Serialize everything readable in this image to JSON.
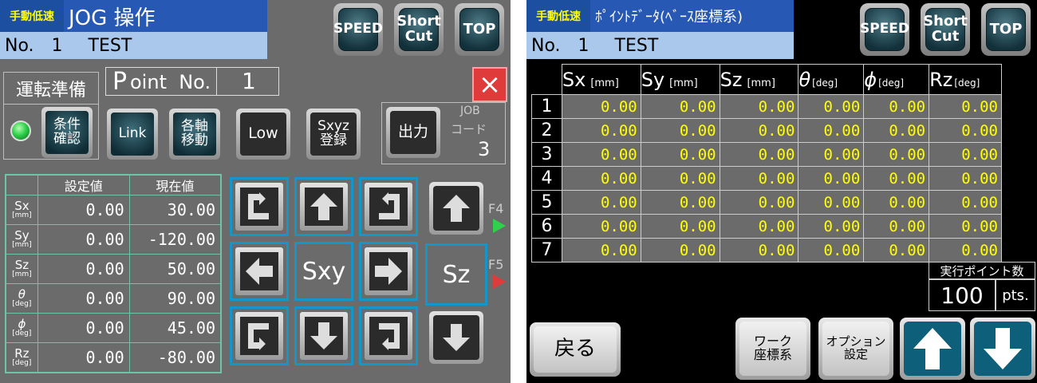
{
  "left": {
    "header": {
      "mode_tag": "手動低速",
      "title": "JOG 操作",
      "no_label": "No.",
      "no_value": "1",
      "name": "TEST"
    },
    "top_buttons": {
      "speed": "SPEED",
      "shortcut_1": "Short",
      "shortcut_2": "Cut",
      "top": "TOP"
    },
    "ready": {
      "label": "運転準備",
      "check_button": "条件\n確認"
    },
    "point": {
      "label_P": "P",
      "label_rest": "oint  No.",
      "value": "1"
    },
    "close_label": "×",
    "buttons": {
      "link": "Link",
      "axis_move": "各軸\n移動",
      "low": "Low",
      "sxyz_register": "Sxyz\n登録",
      "output": "出力"
    },
    "job_code": {
      "label1": "JOB",
      "label2": "コード",
      "value": "3"
    },
    "axis_table": {
      "headers": [
        "設定値",
        "現在値"
      ],
      "rows": [
        {
          "name": "Sx",
          "unit": "[mm]",
          "set": "0.00",
          "current": "30.00"
        },
        {
          "name": "Sy",
          "unit": "[mm]",
          "set": "0.00",
          "current": "-120.00"
        },
        {
          "name": "Sz",
          "unit": "[mm]",
          "set": "0.00",
          "current": "50.00"
        },
        {
          "name": "θ",
          "unit": "[deg]",
          "set": "0.00",
          "current": "90.00"
        },
        {
          "name": "ϕ",
          "unit": "[deg]",
          "set": "0.00",
          "current": "45.00"
        },
        {
          "name": "Rz",
          "unit": "[deg]",
          "set": "0.00",
          "current": "-80.00"
        }
      ]
    },
    "jog": {
      "sxy_label": "Sxy",
      "sz_label": "Sz",
      "f4": "F4",
      "f5": "F5"
    }
  },
  "right": {
    "header": {
      "mode_tag": "手動低速",
      "title": "ﾎﾟｲﾝﾄﾃﾞｰﾀ(ﾍﾞｰｽ座標系)",
      "no_label": "No.",
      "no_value": "1",
      "name": "TEST"
    },
    "top_buttons": {
      "speed": "SPEED",
      "shortcut_1": "Short",
      "shortcut_2": "Cut",
      "top": "TOP"
    },
    "table": {
      "headers": [
        {
          "name": "Sx",
          "unit": "[mm]"
        },
        {
          "name": "Sy",
          "unit": "[mm]"
        },
        {
          "name": "Sz",
          "unit": "[mm]"
        },
        {
          "name": "θ",
          "unit": "[deg]"
        },
        {
          "name": "ϕ",
          "unit": "[deg]"
        },
        {
          "name": "Rz",
          "unit": "[deg]"
        }
      ],
      "rows": [
        {
          "no": "1",
          "values": [
            "0.00",
            "0.00",
            "0.00",
            "0.00",
            "0.00",
            "0.00"
          ]
        },
        {
          "no": "2",
          "values": [
            "0.00",
            "0.00",
            "0.00",
            "0.00",
            "0.00",
            "0.00"
          ]
        },
        {
          "no": "3",
          "values": [
            "0.00",
            "0.00",
            "0.00",
            "0.00",
            "0.00",
            "0.00"
          ]
        },
        {
          "no": "4",
          "values": [
            "0.00",
            "0.00",
            "0.00",
            "0.00",
            "0.00",
            "0.00"
          ]
        },
        {
          "no": "5",
          "values": [
            "0.00",
            "0.00",
            "0.00",
            "0.00",
            "0.00",
            "0.00"
          ]
        },
        {
          "no": "6",
          "values": [
            "0.00",
            "0.00",
            "0.00",
            "0.00",
            "0.00",
            "0.00"
          ]
        },
        {
          "no": "7",
          "values": [
            "0.00",
            "0.00",
            "0.00",
            "0.00",
            "0.00",
            "0.00"
          ]
        }
      ]
    },
    "points_count": {
      "label": "実行ポイント数",
      "value": "100",
      "unit": "pts."
    },
    "buttons": {
      "back": "戻る",
      "work_coord": "ワーク\n座標系",
      "option_setting": "オプション\n設定"
    }
  },
  "colors": {
    "accent_blue": "#2758b3",
    "value_yellow": "#ffff00",
    "jog_border": "#1596c9",
    "close_red": "#e03b3b",
    "led_green": "#2fd14c"
  }
}
